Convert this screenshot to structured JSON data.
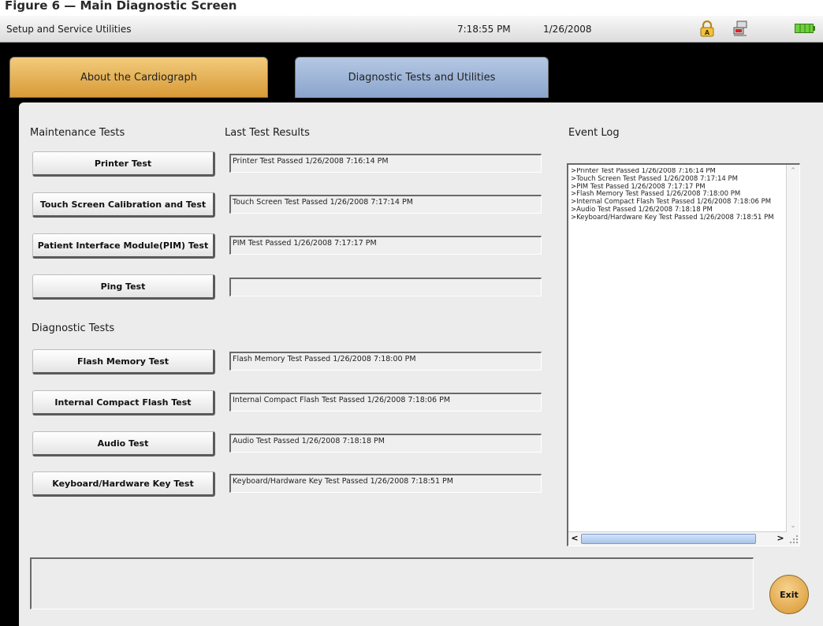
{
  "page_header": "Figure 6 — Main Diagnostic Screen",
  "titlebar": {
    "title": "Setup and Service Utilities",
    "time": "7:18:55 PM",
    "date": "1/26/2008",
    "icons": [
      "lock-icon",
      "network-icon",
      "battery-icon"
    ],
    "battery_color": "#6bd23a"
  },
  "tabs": [
    {
      "label": "About the Cardiograph",
      "selected": false,
      "color": "#e3ac4d"
    },
    {
      "label": "Diagnostic Tests and Utilities",
      "selected": true,
      "color": "#9cb4d8"
    }
  ],
  "sections": {
    "maintenance": "Maintenance Tests",
    "last_results": "Last Test Results",
    "diagnostic": "Diagnostic Tests",
    "event_log": "Event Log"
  },
  "maintenance_tests": [
    {
      "label": "Printer Test",
      "result": "Printer Test Passed 1/26/2008 7:16:14 PM"
    },
    {
      "label": "Touch Screen Calibration and Test",
      "result": "Touch Screen Test Passed 1/26/2008 7:17:14 PM"
    },
    {
      "label": "Patient Interface Module(PIM) Test",
      "result": "PIM Test Passed 1/26/2008 7:17:17 PM"
    },
    {
      "label": "Ping Test",
      "result": ""
    }
  ],
  "diagnostic_tests": [
    {
      "label": "Flash Memory Test",
      "result": "Flash Memory Test Passed 1/26/2008 7:18:00 PM"
    },
    {
      "label": "Internal Compact Flash Test",
      "result": "Internal Compact Flash Test Passed 1/26/2008 7:18:06 PM"
    },
    {
      "label": "Audio Test",
      "result": "Audio Test Passed 1/26/2008 7:18:18 PM"
    },
    {
      "label": "Keyboard/Hardware Key Test",
      "result": "Keyboard/Hardware Key Test Passed 1/26/2008 7:18:51 PM"
    }
  ],
  "event_log": [
    ">Printer Test Passed 1/26/2008 7:16:14 PM",
    ">Touch Screen Test Passed 1/26/2008 7:17:14 PM",
    ">PIM Test Passed 1/26/2008 7:17:17 PM",
    ">Flash Memory Test Passed 1/26/2008 7:18:00 PM",
    ">Internal Compact Flash Test Passed 1/26/2008 7:18:06 PM",
    ">Audio Test Passed 1/26/2008 7:18:18 PM",
    ">Keyboard/Hardware Key Test Passed 1/26/2008 7:18:51 PM"
  ],
  "status_message": "",
  "exit_label": "Exit"
}
